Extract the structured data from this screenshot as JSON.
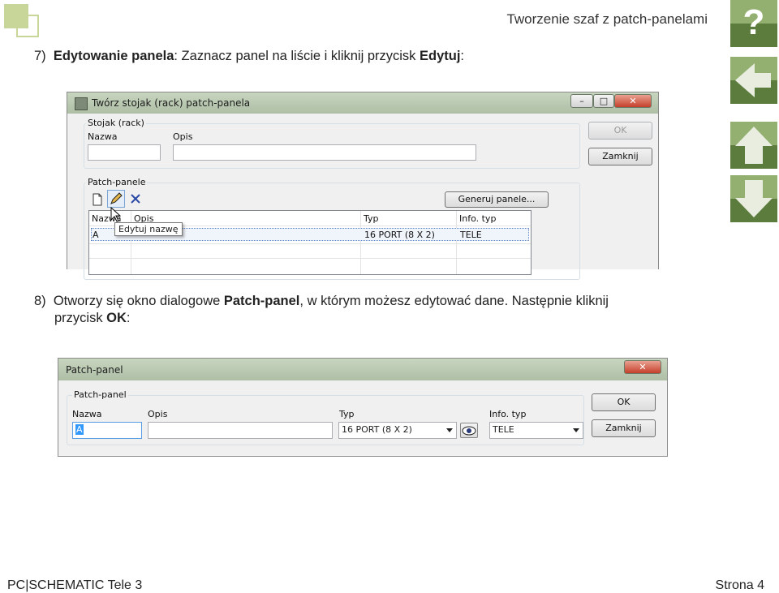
{
  "header": {
    "title": "Tworzenie szaf z patch-panelami"
  },
  "nav": {
    "help_label": "?"
  },
  "step7": {
    "number": "7)",
    "bold1": "Edytowanie panela",
    "text1": ": Zaznacz panel na liście i kliknij przycisk ",
    "bold2": "Edytuj",
    "text2": ":"
  },
  "dialog1": {
    "title": "Twórz stojak (rack) patch-panela",
    "rack_group": "Stojak (rack)",
    "name_label": "Nazwa",
    "desc_label": "Opis",
    "name_value": "",
    "desc_value": "",
    "ok_label": "OK",
    "close_label": "Zamknij",
    "patch_group": "Patch-panele",
    "generate_label": "Generuj panele...",
    "tooltip": "Edytuj nazwę",
    "columns": [
      "Nazwa",
      "Opis",
      "Typ",
      "Info. typ"
    ],
    "rows": [
      {
        "name": "A",
        "desc": "",
        "type": "16 PORT (8 X 2)",
        "info": "TELE"
      }
    ]
  },
  "step8": {
    "number": "8)",
    "text1": "Otworzy się okno dialogowe ",
    "bold1": "Patch-panel",
    "text2": ", w którym możesz edytować dane. Następnie kliknij",
    "text3": "przycisk ",
    "bold2": "OK",
    "text4": ":"
  },
  "dialog2": {
    "title": "Patch-panel",
    "group": "Patch-panel",
    "name_label": "Nazwa",
    "desc_label": "Opis",
    "type_label": "Typ",
    "info_label": "Info. typ",
    "name_value": "A",
    "desc_value": "",
    "type_value": "16 PORT (8 X 2)",
    "info_value": "TELE",
    "ok_label": "OK",
    "close_label": "Zamknij"
  },
  "footer": {
    "left": "PC|SCHEMATIC Tele 3",
    "right": "Strona 4"
  },
  "colors": {
    "accent": "#c9d69a",
    "nav_dark": "#5c7c3d",
    "nav_light": "#93b070"
  }
}
